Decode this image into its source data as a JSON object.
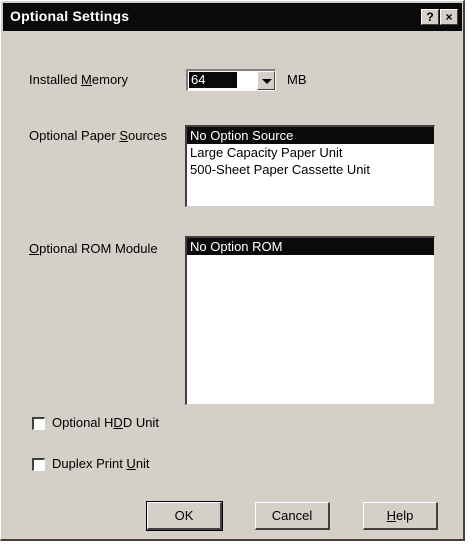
{
  "window": {
    "title": "Optional Settings",
    "help_glyph": "?",
    "close_glyph": "×"
  },
  "memory": {
    "label": "Installed Memory",
    "value": "64",
    "unit": "MB"
  },
  "paper_sources": {
    "label": "Optional Paper Sources",
    "items": [
      "No Option Source",
      "Large Capacity Paper Unit",
      "500-Sheet Paper Cassette Unit"
    ],
    "selected_index": 0
  },
  "rom_module": {
    "label": "Optional ROM Module",
    "items": [
      "No Option ROM"
    ],
    "selected_index": 0
  },
  "checkboxes": {
    "hdd": {
      "label": "Optional HDD Unit",
      "checked": false
    },
    "duplex": {
      "label": "Duplex Print Unit",
      "checked": false
    }
  },
  "buttons": {
    "ok": "OK",
    "cancel": "Cancel",
    "help": "Help"
  }
}
